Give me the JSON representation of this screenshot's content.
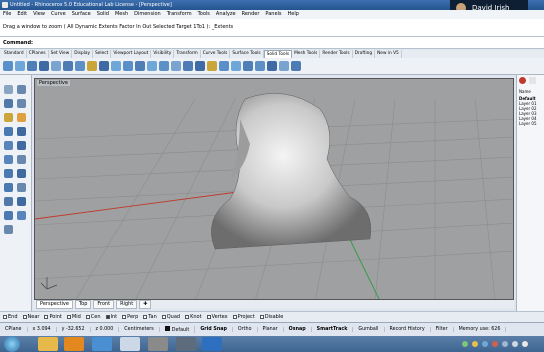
{
  "window": {
    "title": "Untitled - Rhinoceros 5.0 Educational Lab License - [Perspective]",
    "user": "David Irish"
  },
  "menu": [
    "File",
    "Edit",
    "View",
    "Curve",
    "Surface",
    "Solid",
    "Mesh",
    "Dimension",
    "Transform",
    "Tools",
    "Analyze",
    "Render",
    "Panels",
    "Help"
  ],
  "history_text": "Drag a window to zoom ( All  Dynamic  Extents  Factor  In  Out  Selected  Target  1To1 ): _Extents",
  "command_label": "Command:",
  "toolbar_tabs": [
    {
      "label": "Standard",
      "active": false
    },
    {
      "label": "CPlanes",
      "active": false
    },
    {
      "label": "Set View",
      "active": false
    },
    {
      "label": "Display",
      "active": false
    },
    {
      "label": "Select",
      "active": false
    },
    {
      "label": "Viewport Layout",
      "active": false
    },
    {
      "label": "Visibility",
      "active": false
    },
    {
      "label": "Transform",
      "active": false
    },
    {
      "label": "Curve Tools",
      "active": false
    },
    {
      "label": "Surface Tools",
      "active": false
    },
    {
      "label": "Solid Tools",
      "active": true
    },
    {
      "label": "Mesh Tools",
      "active": false
    },
    {
      "label": "Render Tools",
      "active": false
    },
    {
      "label": "Drafting",
      "active": false
    },
    {
      "label": "New in V5",
      "active": false
    }
  ],
  "viewport": {
    "label": "Perspective"
  },
  "viewport_tabs": [
    {
      "label": "Perspective",
      "active": true
    },
    {
      "label": "Top",
      "active": false
    },
    {
      "label": "Front",
      "active": false
    },
    {
      "label": "Right",
      "active": false
    },
    {
      "label": "✚",
      "active": false
    }
  ],
  "osnaps": [
    {
      "label": "End",
      "on": false
    },
    {
      "label": "Near",
      "on": false
    },
    {
      "label": "Point",
      "on": false
    },
    {
      "label": "Mid",
      "on": false
    },
    {
      "label": "Cen",
      "on": false
    },
    {
      "label": "Int",
      "on": true
    },
    {
      "label": "Perp",
      "on": false
    },
    {
      "label": "Tan",
      "on": false
    },
    {
      "label": "Quad",
      "on": false
    },
    {
      "label": "Knot",
      "on": false
    },
    {
      "label": "Vertex",
      "on": false
    },
    {
      "label": "Project",
      "on": false
    },
    {
      "label": "Disable",
      "on": false
    }
  ],
  "status": {
    "cplane": "CPlane",
    "x": "x 3.094",
    "y": "y -32.652",
    "z": "z 0.000",
    "units": "Centimeters",
    "layer": "Default",
    "toggles": [
      "Grid Snap",
      "Ortho",
      "Planar",
      "Osnap",
      "SmartTrack",
      "Gumball",
      "Record History",
      "Filter"
    ],
    "memory": "Memory use: 626"
  },
  "right_panel": {
    "name_header": "Name",
    "layers": [
      "Default",
      "Layer 01",
      "Layer 02",
      "Layer 03",
      "Layer 04",
      "Layer 05"
    ]
  },
  "colors": {
    "titlebar": "#24558f",
    "viewport_bg": "#9fa0a2",
    "axis_x": "#c0392b",
    "axis_y": "#2e9a3e"
  }
}
